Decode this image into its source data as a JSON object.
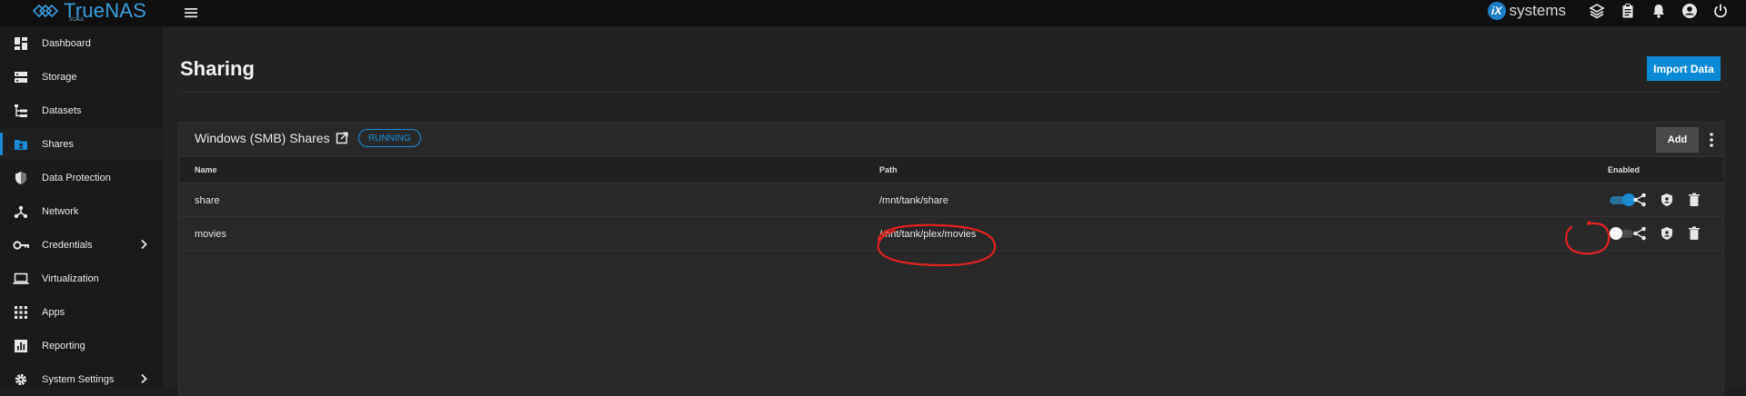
{
  "header": {
    "brand": "TrueNAS",
    "brand_sub": "SCALE",
    "vendor_text": "systems",
    "vendor_mark": "iX"
  },
  "sidebar": {
    "items": [
      {
        "label": "Dashboard",
        "icon": "dashboard-icon"
      },
      {
        "label": "Storage",
        "icon": "storage-icon"
      },
      {
        "label": "Datasets",
        "icon": "datasets-icon"
      },
      {
        "label": "Shares",
        "icon": "shares-icon",
        "active": true
      },
      {
        "label": "Data Protection",
        "icon": "shield-icon"
      },
      {
        "label": "Network",
        "icon": "network-icon"
      },
      {
        "label": "Credentials",
        "icon": "key-icon",
        "expandable": true
      },
      {
        "label": "Virtualization",
        "icon": "laptop-icon"
      },
      {
        "label": "Apps",
        "icon": "apps-grid-icon"
      },
      {
        "label": "Reporting",
        "icon": "reporting-icon"
      },
      {
        "label": "System Settings",
        "icon": "gear-icon",
        "expandable": true
      }
    ]
  },
  "page": {
    "title": "Sharing",
    "import_button": "Import Data"
  },
  "smb_card": {
    "title": "Windows (SMB) Shares",
    "status": "RUNNING",
    "add_button": "Add",
    "columns": {
      "name": "Name",
      "path": "Path",
      "enabled": "Enabled"
    },
    "rows": [
      {
        "name": "share",
        "path": "/mnt/tank/share",
        "enabled": true
      },
      {
        "name": "movies",
        "path": "/mnt/tank/plex/movies",
        "enabled": false
      }
    ]
  },
  "colors": {
    "accent": "#1a8ad4",
    "annotation": "#e02020"
  }
}
